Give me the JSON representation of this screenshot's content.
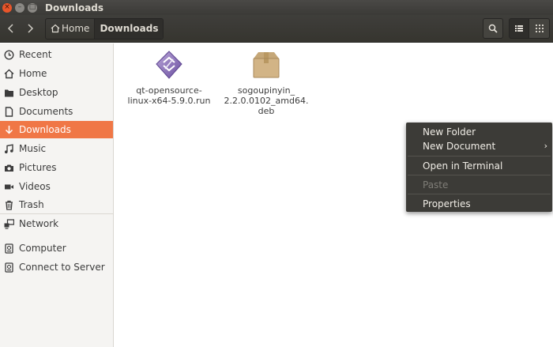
{
  "window": {
    "title": "Downloads",
    "close_glyph": "×",
    "min_glyph": "–",
    "max_glyph": "□"
  },
  "header": {
    "breadcrumb_home": "Home",
    "breadcrumb_current": "Downloads"
  },
  "sidebar": {
    "items": [
      {
        "label": "Recent",
        "icon": "clock-icon"
      },
      {
        "label": "Home",
        "icon": "home-icon"
      },
      {
        "label": "Desktop",
        "icon": "folder-icon"
      },
      {
        "label": "Documents",
        "icon": "document-icon"
      },
      {
        "label": "Downloads",
        "icon": "download-icon",
        "selected": true
      },
      {
        "label": "Music",
        "icon": "music-icon"
      },
      {
        "label": "Pictures",
        "icon": "camera-icon"
      },
      {
        "label": "Videos",
        "icon": "video-icon"
      },
      {
        "label": "Trash",
        "icon": "trash-icon"
      },
      {
        "label": "Network",
        "icon": "network-icon"
      },
      {
        "label": "Computer",
        "icon": "computer-icon"
      },
      {
        "label": "Connect to Server",
        "icon": "server-icon"
      }
    ]
  },
  "files": [
    {
      "line1": "qt-opensource-",
      "line2": "linux-x64-5.9.0.run",
      "line3": "",
      "icon": "run-file-icon"
    },
    {
      "line1": "sogoupinyin_",
      "line2": "2.2.0.0102_amd64.",
      "line3": "deb",
      "icon": "package-icon"
    }
  ],
  "context_menu": {
    "new_folder": "New Folder",
    "new_document": "New Document",
    "open_terminal": "Open in Terminal",
    "paste": "Paste",
    "properties": "Properties",
    "submenu_arrow": "›"
  },
  "colors": {
    "accent": "#f07746",
    "titlebar": "#3b3a37",
    "menu_bg": "#3c3b37"
  }
}
